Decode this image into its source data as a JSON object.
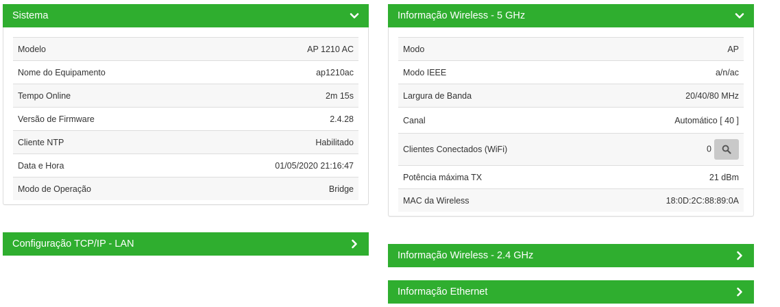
{
  "sistema": {
    "title": "Sistema",
    "rows": [
      {
        "label": "Modelo",
        "value": "AP 1210 AC"
      },
      {
        "label": "Nome do Equipamento",
        "value": "ap1210ac"
      },
      {
        "label": "Tempo Online",
        "value": "2m 15s"
      },
      {
        "label": "Versão de Firmware",
        "value": "2.4.28"
      },
      {
        "label": "Cliente NTP",
        "value": "Habilitado"
      },
      {
        "label": "Data e Hora",
        "value": "01/05/2020 21:16:47"
      },
      {
        "label": "Modo de Operação",
        "value": "Bridge"
      }
    ]
  },
  "tcpip": {
    "title": "Configuração TCP/IP - LAN"
  },
  "wireless5": {
    "title": "Informação Wireless - 5 GHz",
    "rows": [
      {
        "label": "Modo",
        "value": "AP"
      },
      {
        "label": "Modo IEEE",
        "value": "a/n/ac"
      },
      {
        "label": "Largura de Banda",
        "value": "20/40/80 MHz"
      },
      {
        "label": "Canal",
        "value": "Automático [ 40 ]"
      },
      {
        "label": "Clientes Conectados (WiFi)",
        "value": "0"
      },
      {
        "label": "Potência máxima TX",
        "value": "21 dBm"
      },
      {
        "label": "MAC da Wireless",
        "value": "18:0D:2C:88:89:0A"
      }
    ]
  },
  "wireless24": {
    "title": "Informação Wireless - 2.4 GHz"
  },
  "ethernet": {
    "title": "Informação Ethernet"
  },
  "colors": {
    "header_green": "#2fae2f",
    "row_alt": "#f7f7f7",
    "search_button": "#c9c9c9"
  },
  "icons": {
    "expanded": "chevron-down-icon",
    "collapsed": "chevron-right-icon",
    "search": "search-icon"
  }
}
